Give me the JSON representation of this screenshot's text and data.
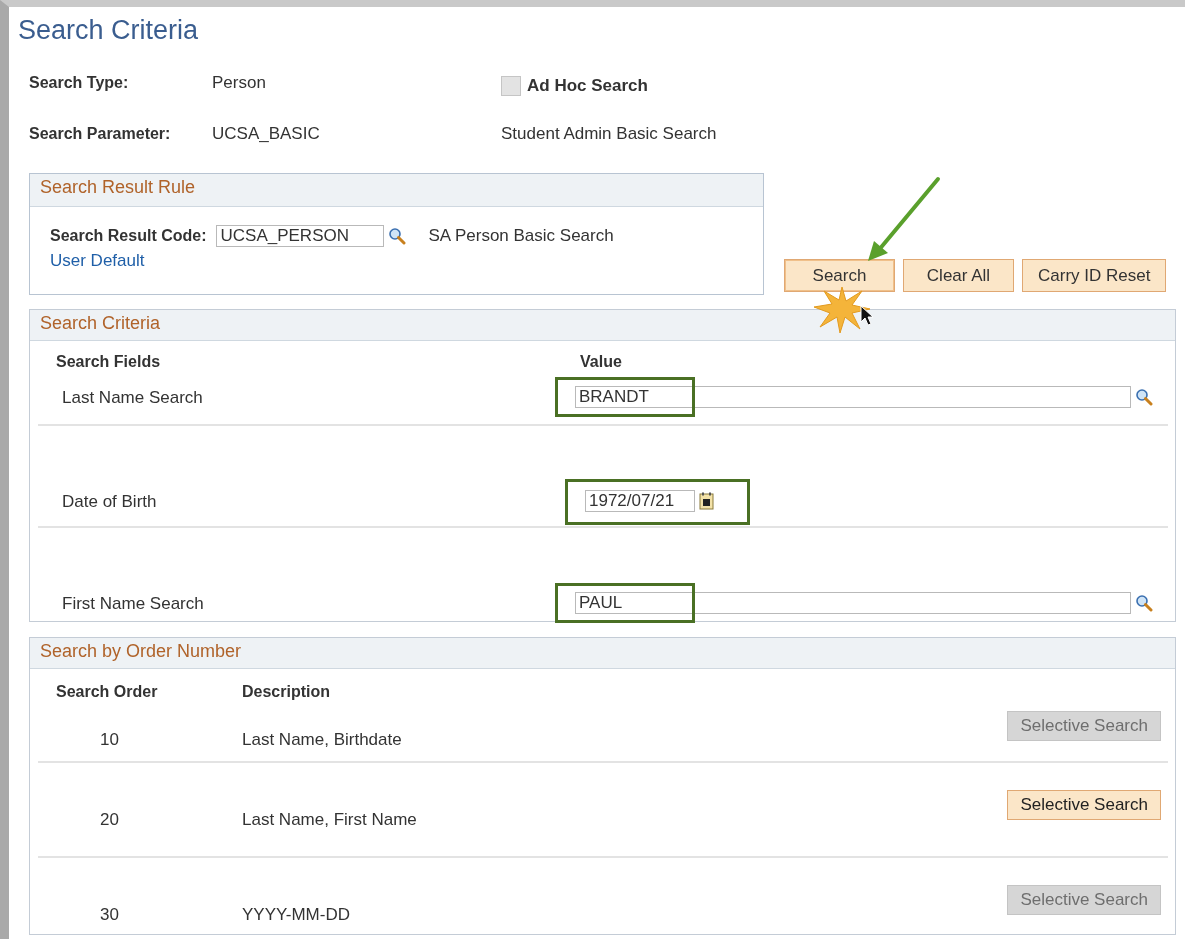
{
  "title": "Search Criteria",
  "search_type": {
    "label": "Search Type:",
    "value": "Person"
  },
  "ad_hoc": {
    "label": "Ad Hoc Search",
    "checked": false
  },
  "search_parameter": {
    "label": "Search Parameter:",
    "value": "UCSA_BASIC",
    "description": "Student Admin Basic Search"
  },
  "result_rule": {
    "heading": "Search Result Rule",
    "label": "Search Result Code:",
    "value": "UCSA_PERSON",
    "description": "SA Person Basic Search",
    "link": "User Default"
  },
  "buttons": [
    {
      "label": "Search",
      "pressed": true
    },
    {
      "label": "Clear All",
      "pressed": false
    },
    {
      "label": "Carry ID Reset",
      "pressed": false
    }
  ],
  "criteria": {
    "heading": "Search Criteria",
    "columns": [
      "Search Fields",
      "Value"
    ],
    "rows": [
      {
        "label": "Last Name Search",
        "value": "BRANDT",
        "kind": "lookup",
        "highlighted": true
      },
      {
        "label": "Date of Birth",
        "value": "1972/07/21",
        "kind": "date",
        "highlighted": true
      },
      {
        "label": "First Name Search",
        "value": "PAUL",
        "kind": "lookup",
        "highlighted": true
      }
    ]
  },
  "order": {
    "heading": "Search by Order Number",
    "columns": [
      "Search Order",
      "Description"
    ],
    "rows": [
      {
        "order": "10",
        "description": "Last Name, Birthdate",
        "button": "Selective Search",
        "disabled": true
      },
      {
        "order": "20",
        "description": "Last Name, First Name",
        "button": "Selective Search",
        "disabled": false
      },
      {
        "order": "30",
        "description": "YYYY-MM-DD",
        "button": "Selective Search",
        "disabled": true
      }
    ]
  }
}
